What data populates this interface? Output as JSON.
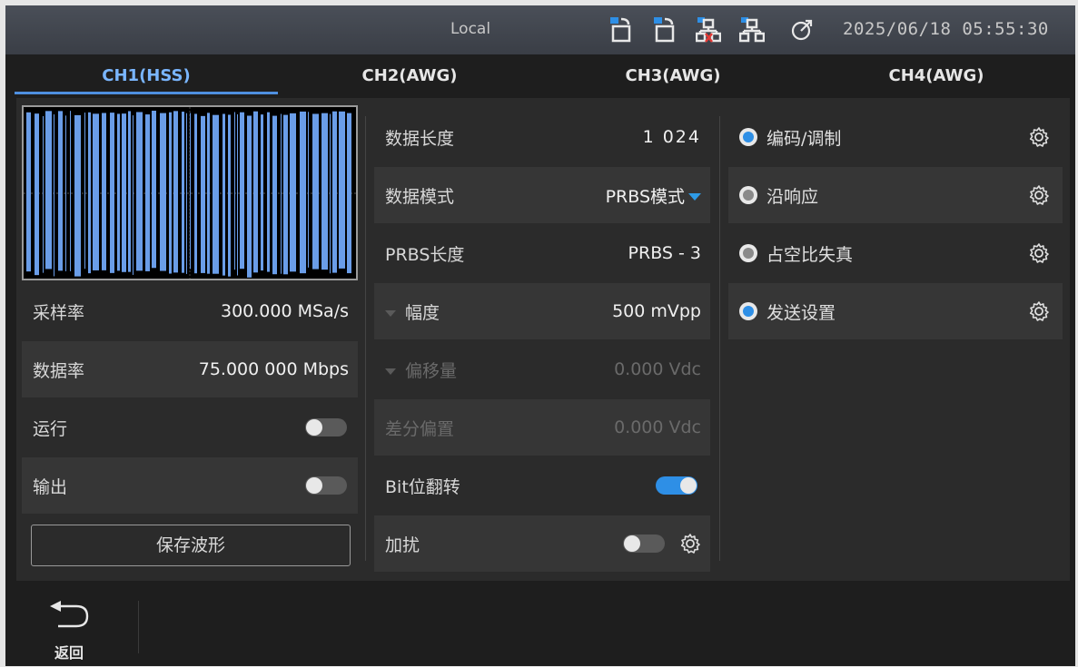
{
  "status": {
    "mode": "Local",
    "datetime": "2025/06/18 05:55:30"
  },
  "tabs": [
    "CH1(HSS)",
    "CH2(AWG)",
    "CH3(AWG)",
    "CH4(AWG)"
  ],
  "active_tab": 0,
  "left": {
    "sample_rate_label": "采样率",
    "sample_rate_value": "300.000 MSa/s",
    "data_rate_label": "数据率",
    "data_rate_value": "75.000 000 Mbps",
    "run_label": "运行",
    "run_on": false,
    "output_label": "输出",
    "output_on": false,
    "save_button": "保存波形"
  },
  "middle": {
    "data_length_label": "数据长度",
    "data_length_value": "1 024",
    "data_mode_label": "数据模式",
    "data_mode_value": "PRBS模式",
    "prbs_length_label": "PRBS长度",
    "prbs_length_value": "PRBS - 3",
    "amplitude_label": "幅度",
    "amplitude_value": "500 mVpp",
    "offset_label": "偏移量",
    "offset_value": "0.000  Vdc",
    "diff_offset_label": "差分偏置",
    "diff_offset_value": "0.000  Vdc",
    "bit_flip_label": "Bit位翻转",
    "bit_flip_on": true,
    "scramble_label": "加扰",
    "scramble_on": false
  },
  "right": {
    "items": [
      {
        "label": "编码/调制",
        "selected": true
      },
      {
        "label": "沿响应",
        "selected": false
      },
      {
        "label": "占空比失真",
        "selected": false
      },
      {
        "label": "发送设置",
        "selected": true
      }
    ]
  },
  "bottom": {
    "back_label": "返回"
  },
  "colors": {
    "accent": "#2e8fe6",
    "waveform": "#6a9de8"
  }
}
